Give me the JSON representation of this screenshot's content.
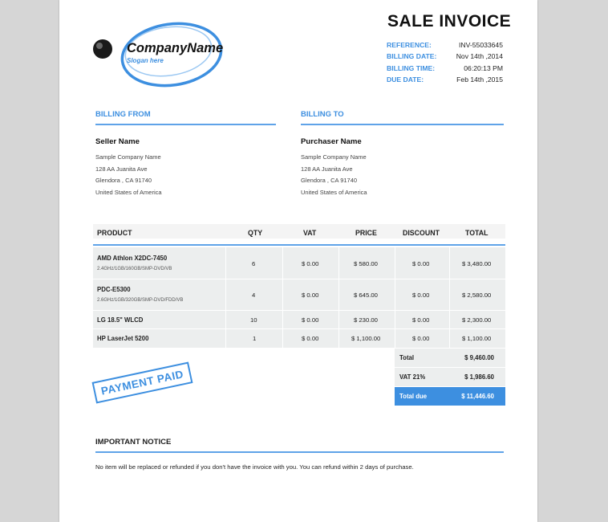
{
  "company": {
    "name": "CompanyName",
    "slogan": "Slogan here"
  },
  "invoice": {
    "title": "SALE INVOICE",
    "meta": [
      {
        "label": "REFERENCE:",
        "value": "INV-55033645"
      },
      {
        "label": "BILLING DATE:",
        "value": "Nov 14th ,2014"
      },
      {
        "label": "BILLING TIME:",
        "value": "06:20:13 PM"
      },
      {
        "label": "DUE DATE:",
        "value": "Feb 14th ,2015"
      }
    ]
  },
  "billing_from": {
    "heading": "BILLING FROM",
    "name": "Seller Name",
    "lines": [
      "Sample Company Name",
      "128 AA Juanita Ave",
      "Glendora , CA 91740",
      "United States of America"
    ]
  },
  "billing_to": {
    "heading": "BILLING TO",
    "name": "Purchaser Name",
    "lines": [
      "Sample Company Name",
      "128 AA Juanita Ave",
      "Glendora , CA 91740",
      "United States of America"
    ]
  },
  "table": {
    "headers": {
      "product": "PRODUCT",
      "qty": "QTY",
      "vat": "VAT",
      "price": "PRICE",
      "discount": "DISCOUNT",
      "total": "TOTAL"
    },
    "rows": [
      {
        "product": "AMD Athlon X2DC-7450",
        "desc": "2.4GHz/1GB/160GB/SMP-DVD/VB",
        "qty": "6",
        "vat": "$ 0.00",
        "price": "$ 580.00",
        "discount": "$ 0.00",
        "total": "$ 3,480.00"
      },
      {
        "product": "PDC-E5300",
        "desc": "2.6GHz/1GB/320GB/SMP-DVD/FDD/VB",
        "qty": "4",
        "vat": "$ 0.00",
        "price": "$ 645.00",
        "discount": "$ 0.00",
        "total": "$ 2,580.00"
      },
      {
        "product": "LG 18.5\" WLCD",
        "desc": "",
        "qty": "10",
        "vat": "$ 0.00",
        "price": "$ 230.00",
        "discount": "$ 0.00",
        "total": "$ 2,300.00"
      },
      {
        "product": "HP LaserJet 5200",
        "desc": "",
        "qty": "1",
        "vat": "$ 0.00",
        "price": "$ 1,100.00",
        "discount": "$ 0.00",
        "total": "$ 1,100.00"
      }
    ]
  },
  "totals": {
    "total_label": "Total",
    "total_value": "$ 9,460.00",
    "vat_label": "VAT 21%",
    "vat_value": "$ 1,986.60",
    "due_label": "Total due",
    "due_value": "$ 11,446.60"
  },
  "stamp": {
    "text": "PAYMENT PAID"
  },
  "notice": {
    "heading": "IMPORTANT NOTICE",
    "text": "No item will be replaced or refunded if you don't have the invoice with you. You can refund within 2 days of purchase."
  },
  "colors": {
    "accent": "#3d8fe0",
    "table_bg": "#eceeee",
    "page_bg": "#d6d6d6"
  }
}
